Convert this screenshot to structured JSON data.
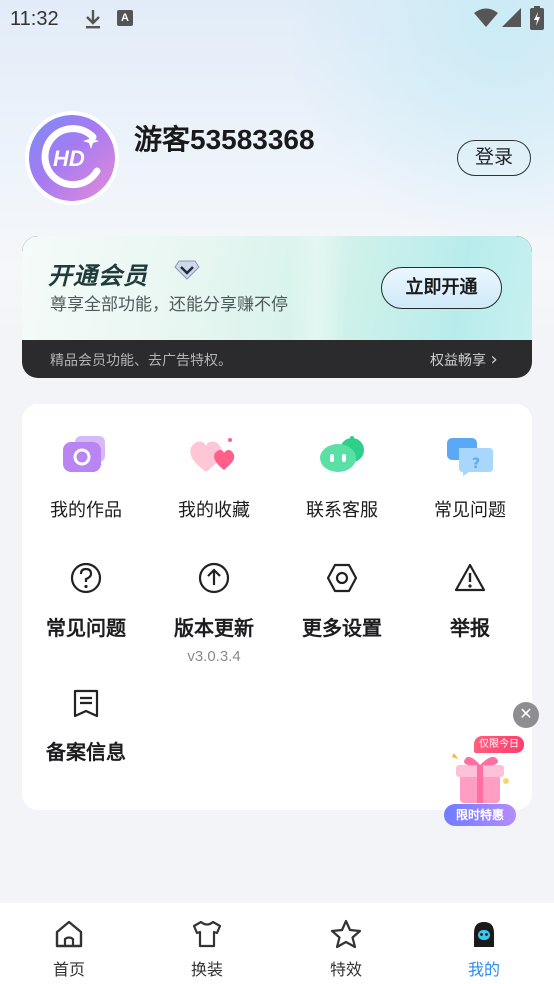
{
  "status_bar": {
    "time": "11:32",
    "notification_a": "A",
    "icons": [
      "download-icon",
      "wifi-icon",
      "signal-icon",
      "battery-icon"
    ]
  },
  "profile": {
    "avatar_text": "HD",
    "username": "游客53583368",
    "login_label": "登录"
  },
  "vip": {
    "title": "开通会员",
    "subtitle": "尊享全部功能，还能分享赚不停",
    "open_button": "立即开通",
    "bottom_text": "精品会员功能、去广告特权。",
    "bottom_link": "权益畅享",
    "bottom_link_icon": "›"
  },
  "menu": {
    "row1": [
      {
        "label": "我的作品",
        "icon": "camera-icon"
      },
      {
        "label": "我的收藏",
        "icon": "hearts-icon"
      },
      {
        "label": "联系客服",
        "icon": "robot-icon"
      },
      {
        "label": "常见问题",
        "icon": "chat-question-icon"
      }
    ],
    "row2": [
      {
        "label": "常见问题",
        "icon": "question-icon"
      },
      {
        "label": "版本更新",
        "icon": "upload-icon",
        "sub": "v3.0.3.4"
      },
      {
        "label": "更多设置",
        "icon": "settings-icon"
      },
      {
        "label": "举报",
        "icon": "warning-icon"
      }
    ],
    "row3": [
      {
        "label": "备案信息",
        "icon": "document-icon"
      }
    ]
  },
  "promo": {
    "tag": "仅限今日",
    "label": "限时特惠",
    "close": "✕"
  },
  "nav": {
    "items": [
      {
        "label": "首页",
        "icon": "home-icon"
      },
      {
        "label": "换装",
        "icon": "shirt-icon"
      },
      {
        "label": "特效",
        "icon": "star-icon"
      },
      {
        "label": "我的",
        "icon": "profile-icon"
      }
    ],
    "active_index": 3
  },
  "colors": {
    "accent": "#2b8cf0",
    "vip_dark": "#2b2b2e"
  }
}
